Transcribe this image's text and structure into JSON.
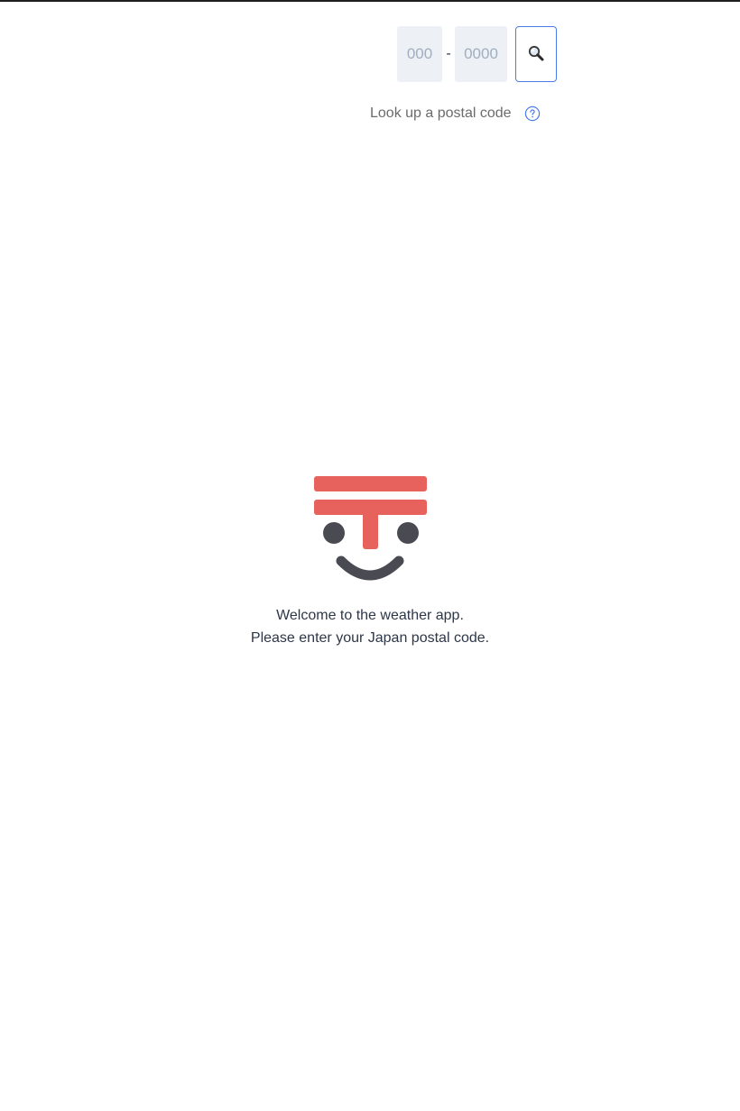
{
  "postal_form": {
    "first_part_placeholder": "000",
    "separator": "-",
    "second_part_placeholder": "0000",
    "search_icon": "magnifier-icon"
  },
  "lookup": {
    "label": "Look up a postal code",
    "help_icon": "question-circle-icon"
  },
  "mascot": {
    "icon": "postal-mark-face-icon",
    "colors": {
      "mark": "#e8625d",
      "face": "#4a4a52"
    }
  },
  "welcome": {
    "line1": "Welcome to the weather app.",
    "line2": "Please enter your Japan postal code."
  },
  "colors": {
    "accent": "#4a7bea",
    "input_bg": "#edf1f6",
    "text": "#2d3748",
    "muted_text": "#6b6b6b"
  }
}
